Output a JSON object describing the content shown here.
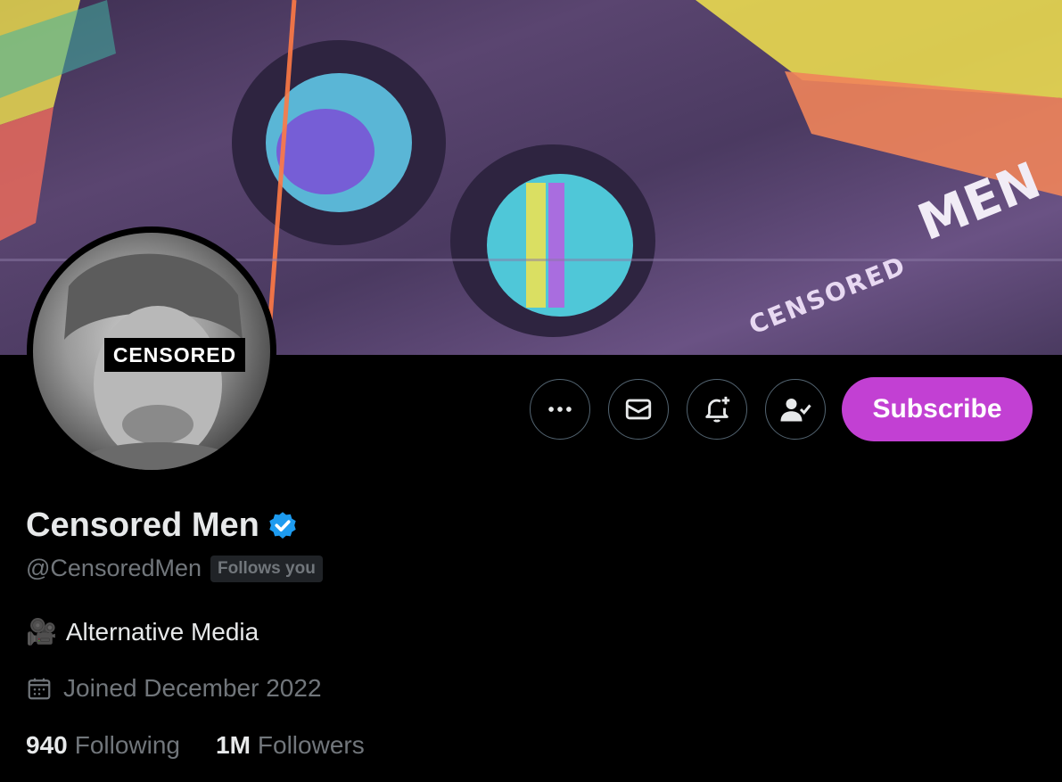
{
  "banner": {
    "text_top": "MEN",
    "text_bottom": "CENSORED"
  },
  "avatar": {
    "censor_label": "CENSORED"
  },
  "actions": {
    "more_icon": "more-horizontal-icon",
    "message_icon": "envelope-icon",
    "notify_icon": "bell-plus-icon",
    "following_icon": "person-check-icon",
    "subscribe_label": "Subscribe",
    "subscribe_color": "#c240d3"
  },
  "profile": {
    "name": "Censored Men",
    "verified": true,
    "handle": "@CensoredMen",
    "follows_you": "Follows you",
    "bio_emoji": "🎥",
    "bio": "Alternative Media",
    "joined": "Joined December 2022",
    "following_count": "940",
    "following_label": "Following",
    "followers_count": "1M",
    "followers_label": "Followers"
  },
  "colors": {
    "background": "#000000",
    "text": "#e7e9ea",
    "muted": "#71767b",
    "verified": "#1d9bf0"
  }
}
